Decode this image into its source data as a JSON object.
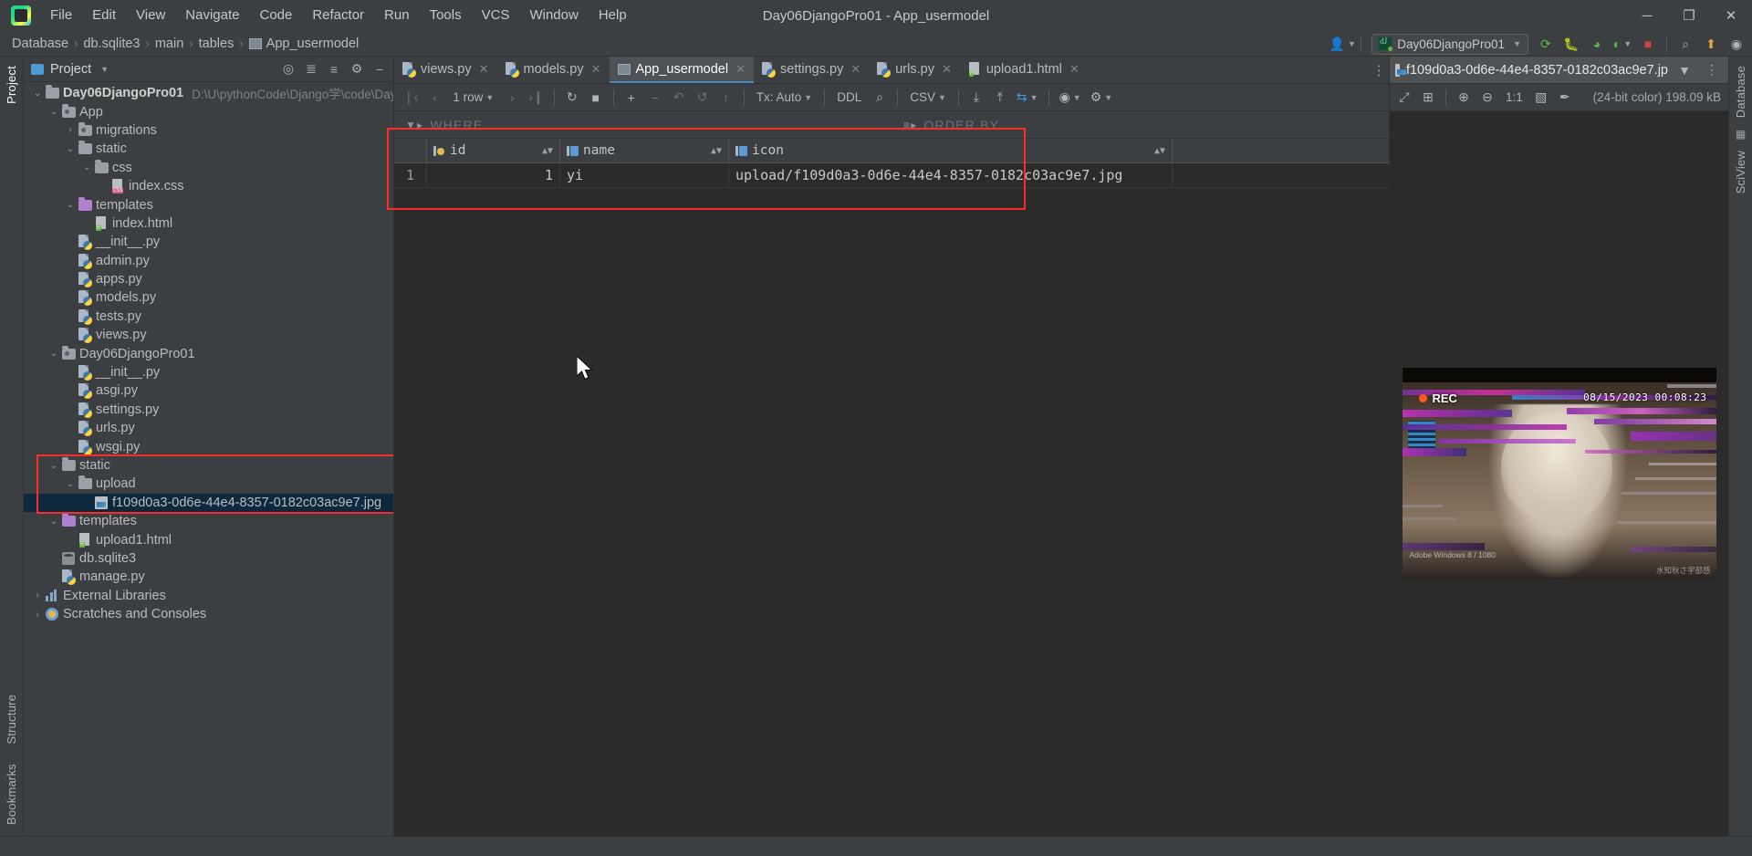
{
  "window": {
    "title": "Day06DjangoPro01 - App_usermodel",
    "minimize_label": "─",
    "maximize_label": "❐",
    "close_label": "✕"
  },
  "menu": {
    "items": [
      "File",
      "Edit",
      "View",
      "Navigate",
      "Code",
      "Refactor",
      "Run",
      "Tools",
      "VCS",
      "Window",
      "Help"
    ]
  },
  "navbar": {
    "crumbs": [
      "Database",
      "db.sqlite3",
      "main",
      "tables",
      "App_usermodel"
    ],
    "separator": "›",
    "run_config": "Day06DjangoPro01"
  },
  "project_panel": {
    "title": "Project",
    "tree": [
      {
        "depth": 0,
        "arrow": "down",
        "icon": "folder",
        "label": "Day06DjangoPro01",
        "bold": true,
        "path": "D:\\U\\pythonCode\\Django学\\code\\Day"
      },
      {
        "depth": 1,
        "arrow": "down",
        "icon": "folder-module",
        "label": "App"
      },
      {
        "depth": 2,
        "arrow": "right",
        "icon": "folder-module",
        "label": "migrations"
      },
      {
        "depth": 2,
        "arrow": "down",
        "icon": "folder",
        "label": "static"
      },
      {
        "depth": 3,
        "arrow": "down",
        "icon": "folder",
        "label": "css"
      },
      {
        "depth": 4,
        "arrow": "none",
        "icon": "file-css",
        "label": "index.css"
      },
      {
        "depth": 2,
        "arrow": "down",
        "icon": "folder-purple",
        "label": "templates"
      },
      {
        "depth": 3,
        "arrow": "none",
        "icon": "file-html",
        "label": "index.html"
      },
      {
        "depth": 2,
        "arrow": "none",
        "icon": "file-py",
        "label": "__init__.py"
      },
      {
        "depth": 2,
        "arrow": "none",
        "icon": "file-py",
        "label": "admin.py"
      },
      {
        "depth": 2,
        "arrow": "none",
        "icon": "file-py",
        "label": "apps.py"
      },
      {
        "depth": 2,
        "arrow": "none",
        "icon": "file-py",
        "label": "models.py"
      },
      {
        "depth": 2,
        "arrow": "none",
        "icon": "file-py",
        "label": "tests.py"
      },
      {
        "depth": 2,
        "arrow": "none",
        "icon": "file-py",
        "label": "views.py"
      },
      {
        "depth": 1,
        "arrow": "down",
        "icon": "folder-module",
        "label": "Day06DjangoPro01"
      },
      {
        "depth": 2,
        "arrow": "none",
        "icon": "file-py",
        "label": "__init__.py"
      },
      {
        "depth": 2,
        "arrow": "none",
        "icon": "file-py",
        "label": "asgi.py"
      },
      {
        "depth": 2,
        "arrow": "none",
        "icon": "file-py",
        "label": "settings.py"
      },
      {
        "depth": 2,
        "arrow": "none",
        "icon": "file-py",
        "label": "urls.py"
      },
      {
        "depth": 2,
        "arrow": "none",
        "icon": "file-py",
        "label": "wsgi.py"
      },
      {
        "depth": 1,
        "arrow": "down",
        "icon": "folder",
        "label": "static"
      },
      {
        "depth": 2,
        "arrow": "down",
        "icon": "folder",
        "label": "upload"
      },
      {
        "depth": 3,
        "arrow": "none",
        "icon": "file-image",
        "label": "f109d0a3-0d6e-44e4-8357-0182c03ac9e7.jpg",
        "selected": true
      },
      {
        "depth": 1,
        "arrow": "down",
        "icon": "folder-purple",
        "label": "templates"
      },
      {
        "depth": 2,
        "arrow": "none",
        "icon": "file-html",
        "label": "upload1.html"
      },
      {
        "depth": 1,
        "arrow": "none",
        "icon": "file-db",
        "label": "db.sqlite3"
      },
      {
        "depth": 1,
        "arrow": "none",
        "icon": "file-py",
        "label": "manage.py"
      },
      {
        "depth": 0,
        "arrow": "right",
        "icon": "libraries",
        "label": "External Libraries"
      },
      {
        "depth": 0,
        "arrow": "right",
        "icon": "scratches",
        "label": "Scratches and Consoles"
      }
    ]
  },
  "editor_tabs": [
    {
      "label": "views.py",
      "icon": "python-file-icon",
      "active": false
    },
    {
      "label": "models.py",
      "icon": "python-file-icon",
      "active": false
    },
    {
      "label": "App_usermodel",
      "icon": "db-table-icon",
      "active": true
    },
    {
      "label": "settings.py",
      "icon": "python-file-icon",
      "active": false
    },
    {
      "label": "urls.py",
      "icon": "python-file-icon",
      "active": false
    },
    {
      "label": "upload1.html",
      "icon": "html-file-icon",
      "active": false
    }
  ],
  "db_toolbar": {
    "first_label": "❘‹",
    "prev_label": "‹",
    "rows_label": "1 row",
    "next_label": "›",
    "last_label": "›❙",
    "refresh_label": "↻",
    "stop_label": "■",
    "add_label": "+",
    "remove_label": "−",
    "revert_label": "↶",
    "revert_sel_label": "↺",
    "submit_label": "↑",
    "tx_label": "Tx: Auto",
    "ddl_label": "DDL",
    "search_label": "⌕",
    "export_format": "CSV",
    "download_label": "⤓",
    "upload_label": "⤒",
    "modify_label": "⇆",
    "view_label": "◉",
    "settings_label": "⚙"
  },
  "filter_bar": {
    "where_label": "WHERE",
    "order_label": "ORDER BY",
    "filter_icon": "filter-icon",
    "sort_icon": "sort-icon"
  },
  "grid": {
    "columns": [
      {
        "name": "id",
        "icon": "primary-key-column-icon",
        "sortable": true
      },
      {
        "name": "name",
        "icon": "column-icon",
        "sortable": true
      },
      {
        "name": "icon",
        "icon": "column-icon",
        "sortable": false
      }
    ],
    "rows": [
      {
        "rownum": "1",
        "id": "1",
        "name": "yi",
        "icon": "upload/f109d0a3-0d6e-44e4-8357-0182c03ac9e7.jpg"
      }
    ]
  },
  "image_panel": {
    "tab_label": "f109d0a3-0d6e-44e4-8357-0182c03ac9e7.jp",
    "tab_icon": "image-file-icon",
    "toolbar": {
      "fit_label": "⤢",
      "grid_label": "⊞",
      "zoom_in_label": "⊕",
      "zoom_out_label": "⊖",
      "actual_size_label": "1:1",
      "transparency_label": "▧",
      "color_picker_label": "✒"
    },
    "info": "(24-bit color) 198.09 kB",
    "overlay": {
      "rec_label": "REC",
      "timestamp": "08/15/2023  00:08:23",
      "watermark": "Adobe Windows 8 / 1080",
      "corner_watermark": "水知秋さ宇部感"
    }
  },
  "left_strip": {
    "items": [
      "Project",
      "Structure",
      "Bookmarks"
    ],
    "active": "Project"
  },
  "right_strip": {
    "items": [
      "Database",
      "SciView"
    ]
  },
  "colors": {
    "accent": "#4a88c7",
    "highlight_red": "#ff2a2a",
    "selection": "#0d293e",
    "background": "#3c3f41",
    "editor_bg": "#2b2b2b"
  }
}
